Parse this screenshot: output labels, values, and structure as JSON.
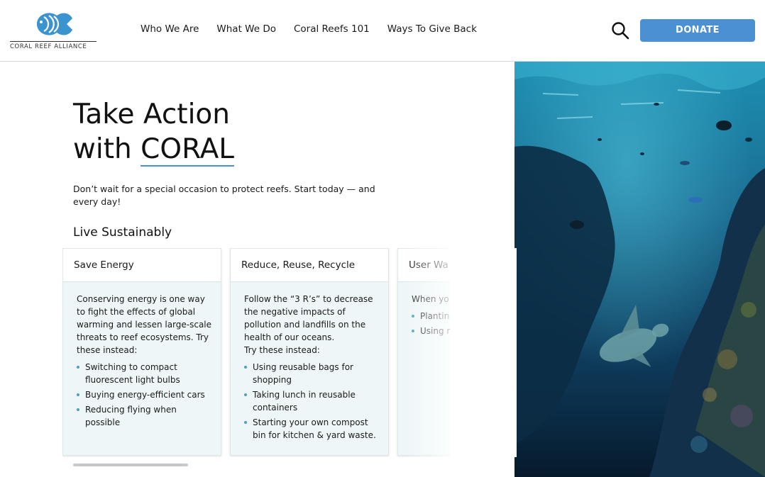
{
  "header": {
    "logo_text": "CORAL REEF ALLIANCE",
    "nav": [
      "Who We Are",
      "What We Do",
      "Coral Reefs 101",
      "Ways To Give Back"
    ],
    "search_icon": "search-icon",
    "donate_label": "DONATE"
  },
  "hero": {
    "title_line1": "Take Action",
    "title_line2_prefix": "with ",
    "title_line2_accent": "CORAL",
    "subtitle": "Don’t wait for a special occasion to protect reefs.  Start today — and every day!",
    "section_heading": "Live Sustainably"
  },
  "cards": [
    {
      "title": "Save Energy",
      "intro": "Conserving energy is one way to fight the effects of global warming and lessen large-scale threats to reef ecosystems. Try these instead:",
      "items": [
        "Switching to compact fluorescent light bulbs",
        "Buying energy-efficient cars",
        "Reducing flying when possible"
      ]
    },
    {
      "title": "Reduce, Reuse, Recycle",
      "intro": "Follow the “3 R’s” to decrease the negative impacts of pollution and landfills on the health of our oceans.",
      "intro2": "Try these instead:",
      "items": [
        "Using reusable bags for shopping",
        "Taking lunch in reusable containers",
        "Starting your own compost bin for kitchen & yard waste."
      ]
    },
    {
      "title": "User Wa",
      "intro": "When yo wastewa ocean. Tr",
      "items": [
        "Plantin absorb hard su home",
        "Using r garden less any fer"
      ]
    }
  ],
  "colors": {
    "accent": "#4a90d3",
    "card_bg": "#eef6f7",
    "bullet": "#4aa3b5"
  },
  "photo": {
    "subject": "underwater-coral-reef-with-sea-turtle"
  }
}
